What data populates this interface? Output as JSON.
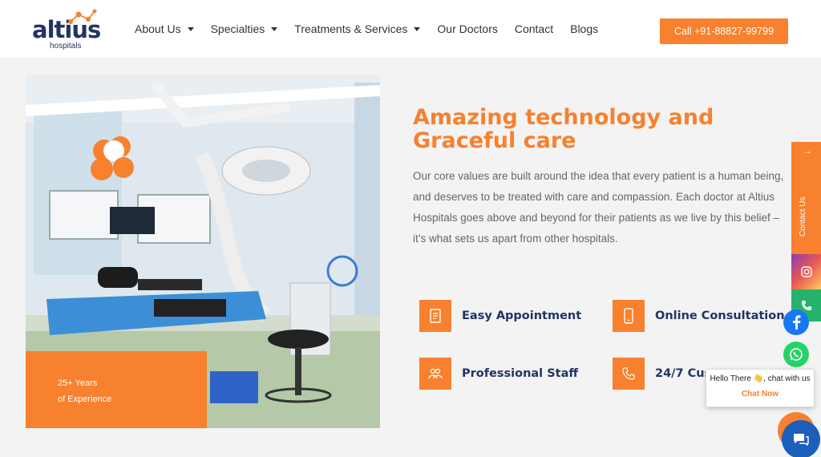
{
  "header": {
    "logo_text": "altius",
    "logo_sub": "hospitals",
    "nav": [
      {
        "label": "About Us",
        "dropdown": true
      },
      {
        "label": "Specialties",
        "dropdown": true
      },
      {
        "label": "Treatments & Services",
        "dropdown": true
      },
      {
        "label": "Our Doctors",
        "dropdown": false
      },
      {
        "label": "Contact",
        "dropdown": false
      },
      {
        "label": "Blogs",
        "dropdown": false
      }
    ],
    "call_label": "Call +91-88827-99799"
  },
  "experience": {
    "line1": "25+ Years",
    "line2": "of Experience"
  },
  "section": {
    "headline": "Amazing technology and Graceful care",
    "description": "Our core values are built around the idea that every patient is a human being, and deserves to be treated with care and compassion. Each doctor at Altius Hospitals goes above and beyond for their patients as we live by this belief – it’s what sets us apart from other hospitals."
  },
  "features": [
    {
      "label": "Easy Appointment",
      "icon": "document-icon"
    },
    {
      "label": "Online Consultation",
      "icon": "mobile-icon"
    },
    {
      "label": "Professional Staff",
      "icon": "staff-icon"
    },
    {
      "label": "24/7 Cus",
      "icon": "phone-icon"
    }
  ],
  "floating": {
    "contact_label": "Contact Us",
    "chat_greeting": "Hello There 👋, chat with us",
    "chat_cta": "Chat Now"
  },
  "colors": {
    "accent": "#f7812e",
    "navy": "#223463",
    "facebook": "#1877f2",
    "whatsapp": "#25d366"
  }
}
